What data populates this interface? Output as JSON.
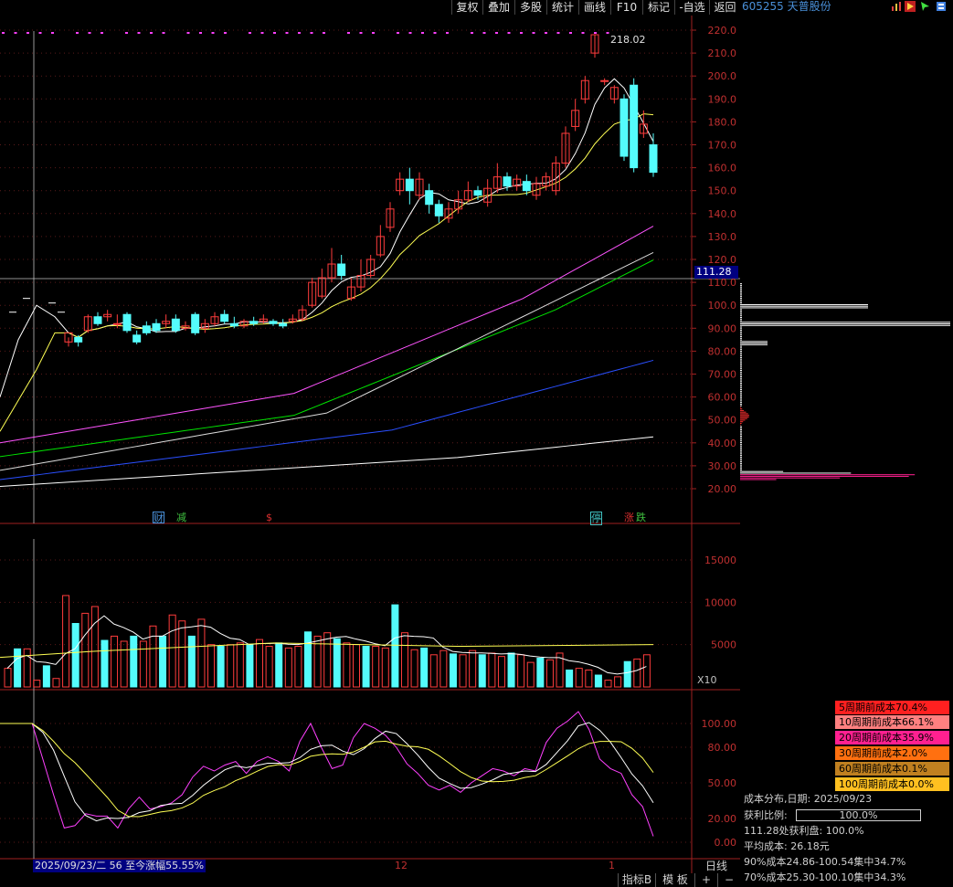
{
  "toolbar": {
    "buttons": [
      "复权",
      "叠加",
      "多股",
      "统计",
      "画线",
      "F10",
      "标记",
      "-自选",
      "返回"
    ]
  },
  "stock": {
    "code_name": "605255 天普股份"
  },
  "price_axis": {
    "labels": [
      "220.0",
      "210.0",
      "200.0",
      "190.0",
      "180.0",
      "170.0",
      "160.0",
      "150.0",
      "140.0",
      "130.0",
      "120.0",
      "110.0",
      "100.0",
      "90.00",
      "80.00",
      "70.00",
      "60.00",
      "50.00",
      "40.00",
      "30.00",
      "20.00"
    ],
    "current_price_tag": "111.28",
    "peak_label": "218.02"
  },
  "volume_axis": {
    "labels": [
      "15000",
      "10000",
      "5000"
    ],
    "unit": "X10"
  },
  "indicator_axis": {
    "labels": [
      "100.00",
      "80.00",
      "50.00",
      "20.00",
      "0.00"
    ]
  },
  "markers": [
    {
      "text": "财",
      "color": "#4a90d9"
    },
    {
      "text": "减",
      "color": "#40c040"
    },
    {
      "text": "$",
      "color": "#e03030"
    },
    {
      "text": "停",
      "color": "#40c0c0"
    },
    {
      "text": "涨",
      "color": "#e03030"
    },
    {
      "text": "跌",
      "color": "#40c040"
    }
  ],
  "time_axis": {
    "labels": [
      "12",
      "1"
    ],
    "range_text": "2025/09/23/二 56 至今涨幅55.55%"
  },
  "cost_rows": [
    {
      "label": "5周期前成本70.4%",
      "color": "#ff2020"
    },
    {
      "label": "10周期前成本66.1%",
      "color": "#ff8080"
    },
    {
      "label": "20周期前成本35.9%",
      "color": "#ff2090"
    },
    {
      "label": "30周期前成本2.0%",
      "color": "#ff7010"
    },
    {
      "label": "60周期前成本0.1%",
      "color": "#c08020"
    },
    {
      "label": "100周期前成本0.0%",
      "color": "#ffc020"
    }
  ],
  "cost_info": {
    "date_line": "成本分布,日期:  2025/09/23",
    "profit_label": "获利比例:",
    "profit_value": "100.0%",
    "profit_at": "111.28处获利盘:  100.0%",
    "avg_cost": "平均成本:  26.18元",
    "c90": "90%成本24.86-100.54集中34.7%",
    "c70": "70%成本25.30-100.10集中34.3%"
  },
  "bottom_tabs": [
    "指标B",
    "模 板",
    "+",
    "−",
    "日线"
  ],
  "colors": {
    "up": "#ff3c3c",
    "down": "#54fcfc",
    "ma5": "#ffffff",
    "ma10": "#ffff54",
    "ma20": "#ff54ff",
    "ma30": "#00e600",
    "ma60": "#dcdcdc",
    "ma120": "#2a4fff",
    "ma250": "#ffffff"
  }
}
